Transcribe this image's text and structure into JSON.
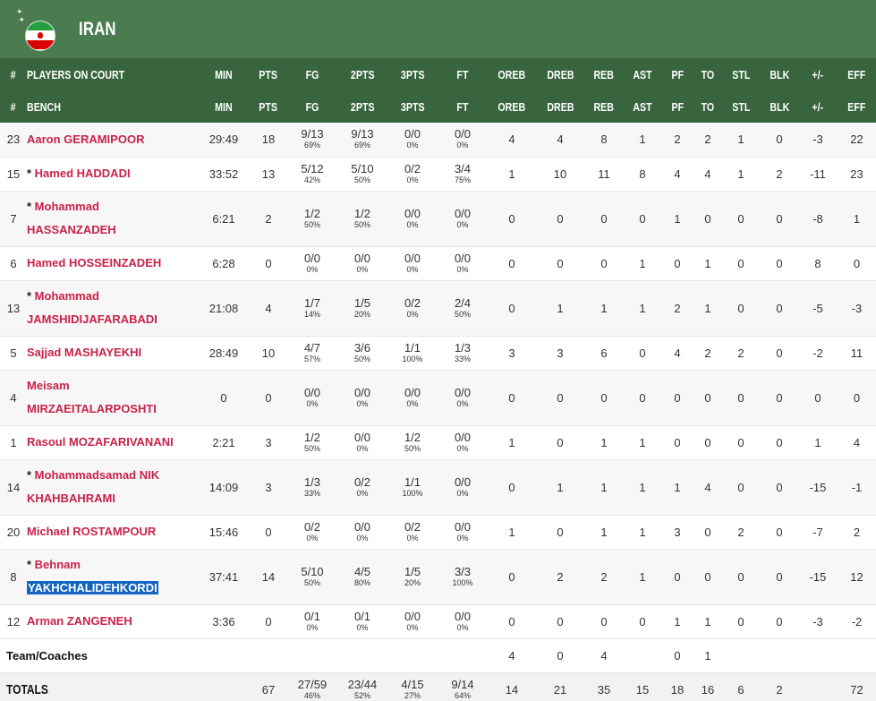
{
  "team": {
    "name": "IRAN",
    "colors": {
      "header": "#4b7c4f",
      "table_header": "#38653d",
      "player_link": "#c8224a"
    }
  },
  "columns_court": [
    "#",
    "PLAYERS ON COURT",
    "MIN",
    "PTS",
    "FG",
    "2PTS",
    "3PTS",
    "FT",
    "OREB",
    "DREB",
    "REB",
    "AST",
    "PF",
    "TO",
    "STL",
    "BLK",
    "+/-",
    "EFF"
  ],
  "columns_bench": [
    "#",
    "BENCH",
    "MIN",
    "PTS",
    "FG",
    "2PTS",
    "3PTS",
    "FT",
    "OREB",
    "DREB",
    "REB",
    "AST",
    "PF",
    "TO",
    "STL",
    "BLK",
    "+/-",
    "EFF"
  ],
  "players": [
    {
      "no": "23",
      "star": false,
      "name1": "Aaron GERAMIPOOR",
      "name2": "",
      "min": "29:49",
      "pts": "18",
      "fg": "9/13",
      "fg_pct": "69%",
      "p2": "9/13",
      "p2_pct": "69%",
      "p3": "0/0",
      "p3_pct": "0%",
      "ft": "0/0",
      "ft_pct": "0%",
      "oreb": "4",
      "dreb": "4",
      "reb": "8",
      "ast": "1",
      "pf": "2",
      "to": "2",
      "stl": "1",
      "blk": "0",
      "pm": "-3",
      "eff": "22"
    },
    {
      "no": "15",
      "star": true,
      "name1": "Hamed HADDADI",
      "name2": "",
      "min": "33:52",
      "pts": "13",
      "fg": "5/12",
      "fg_pct": "42%",
      "p2": "5/10",
      "p2_pct": "50%",
      "p3": "0/2",
      "p3_pct": "0%",
      "ft": "3/4",
      "ft_pct": "75%",
      "oreb": "1",
      "dreb": "10",
      "reb": "11",
      "ast": "8",
      "pf": "4",
      "to": "4",
      "stl": "1",
      "blk": "2",
      "pm": "-11",
      "eff": "23"
    },
    {
      "no": "7",
      "star": true,
      "name1": "Mohammad",
      "name2": "HASSANZADEH",
      "min": "6:21",
      "pts": "2",
      "fg": "1/2",
      "fg_pct": "50%",
      "p2": "1/2",
      "p2_pct": "50%",
      "p3": "0/0",
      "p3_pct": "0%",
      "ft": "0/0",
      "ft_pct": "0%",
      "oreb": "0",
      "dreb": "0",
      "reb": "0",
      "ast": "0",
      "pf": "1",
      "to": "0",
      "stl": "0",
      "blk": "0",
      "pm": "-8",
      "eff": "1"
    },
    {
      "no": "6",
      "star": false,
      "name1": "Hamed HOSSEINZADEH",
      "name2": "",
      "min": "6:28",
      "pts": "0",
      "fg": "0/0",
      "fg_pct": "0%",
      "p2": "0/0",
      "p2_pct": "0%",
      "p3": "0/0",
      "p3_pct": "0%",
      "ft": "0/0",
      "ft_pct": "0%",
      "oreb": "0",
      "dreb": "0",
      "reb": "0",
      "ast": "1",
      "pf": "0",
      "to": "1",
      "stl": "0",
      "blk": "0",
      "pm": "8",
      "eff": "0"
    },
    {
      "no": "13",
      "star": true,
      "name1": "Mohammad",
      "name2": "JAMSHIDIJAFARABADI",
      "min": "21:08",
      "pts": "4",
      "fg": "1/7",
      "fg_pct": "14%",
      "p2": "1/5",
      "p2_pct": "20%",
      "p3": "0/2",
      "p3_pct": "0%",
      "ft": "2/4",
      "ft_pct": "50%",
      "oreb": "0",
      "dreb": "1",
      "reb": "1",
      "ast": "1",
      "pf": "2",
      "to": "1",
      "stl": "0",
      "blk": "0",
      "pm": "-5",
      "eff": "-3"
    },
    {
      "no": "5",
      "star": false,
      "name1": "Sajjad MASHAYEKHI",
      "name2": "",
      "min": "28:49",
      "pts": "10",
      "fg": "4/7",
      "fg_pct": "57%",
      "p2": "3/6",
      "p2_pct": "50%",
      "p3": "1/1",
      "p3_pct": "100%",
      "ft": "1/3",
      "ft_pct": "33%",
      "oreb": "3",
      "dreb": "3",
      "reb": "6",
      "ast": "0",
      "pf": "4",
      "to": "2",
      "stl": "2",
      "blk": "0",
      "pm": "-2",
      "eff": "11"
    },
    {
      "no": "4",
      "star": false,
      "name1": "Meisam",
      "name2": "MIRZAEITALARPOSHTI",
      "min": "0",
      "pts": "0",
      "fg": "0/0",
      "fg_pct": "0%",
      "p2": "0/0",
      "p2_pct": "0%",
      "p3": "0/0",
      "p3_pct": "0%",
      "ft": "0/0",
      "ft_pct": "0%",
      "oreb": "0",
      "dreb": "0",
      "reb": "0",
      "ast": "0",
      "pf": "0",
      "to": "0",
      "stl": "0",
      "blk": "0",
      "pm": "0",
      "eff": "0"
    },
    {
      "no": "1",
      "star": false,
      "name1": "Rasoul MOZAFARIVANANI",
      "name2": "",
      "min": "2:21",
      "pts": "3",
      "fg": "1/2",
      "fg_pct": "50%",
      "p2": "0/0",
      "p2_pct": "0%",
      "p3": "1/2",
      "p3_pct": "50%",
      "ft": "0/0",
      "ft_pct": "0%",
      "oreb": "1",
      "dreb": "0",
      "reb": "1",
      "ast": "1",
      "pf": "0",
      "to": "0",
      "stl": "0",
      "blk": "0",
      "pm": "1",
      "eff": "4"
    },
    {
      "no": "14",
      "star": true,
      "name1": "Mohammadsamad NIK",
      "name2": "KHAHBAHRAMI",
      "min": "14:09",
      "pts": "3",
      "fg": "1/3",
      "fg_pct": "33%",
      "p2": "0/2",
      "p2_pct": "0%",
      "p3": "1/1",
      "p3_pct": "100%",
      "ft": "0/0",
      "ft_pct": "0%",
      "oreb": "0",
      "dreb": "1",
      "reb": "1",
      "ast": "1",
      "pf": "1",
      "to": "4",
      "stl": "0",
      "blk": "0",
      "pm": "-15",
      "eff": "-1"
    },
    {
      "no": "20",
      "star": false,
      "name1": "Michael ROSTAMPOUR",
      "name2": "",
      "min": "15:46",
      "pts": "0",
      "fg": "0/2",
      "fg_pct": "0%",
      "p2": "0/0",
      "p2_pct": "0%",
      "p3": "0/2",
      "p3_pct": "0%",
      "ft": "0/0",
      "ft_pct": "0%",
      "oreb": "1",
      "dreb": "0",
      "reb": "1",
      "ast": "1",
      "pf": "3",
      "to": "0",
      "stl": "2",
      "blk": "0",
      "pm": "-7",
      "eff": "2"
    },
    {
      "no": "8",
      "star": true,
      "name1": "Behnam",
      "name2": "YAKHCHALIDEHKORDI",
      "name2_selected": true,
      "min": "37:41",
      "pts": "14",
      "fg": "5/10",
      "fg_pct": "50%",
      "p2": "4/5",
      "p2_pct": "80%",
      "p3": "1/5",
      "p3_pct": "20%",
      "ft": "3/3",
      "ft_pct": "100%",
      "oreb": "0",
      "dreb": "2",
      "reb": "2",
      "ast": "1",
      "pf": "0",
      "to": "0",
      "stl": "0",
      "blk": "0",
      "pm": "-15",
      "eff": "12"
    },
    {
      "no": "12",
      "star": false,
      "name1": "Arman ZANGENEH",
      "name2": "",
      "min": "3:36",
      "pts": "0",
      "fg": "0/1",
      "fg_pct": "0%",
      "p2": "0/1",
      "p2_pct": "0%",
      "p3": "0/0",
      "p3_pct": "0%",
      "ft": "0/0",
      "ft_pct": "0%",
      "oreb": "0",
      "dreb": "0",
      "reb": "0",
      "ast": "0",
      "pf": "1",
      "to": "1",
      "stl": "0",
      "blk": "0",
      "pm": "-3",
      "eff": "-2"
    }
  ],
  "team_coaches": {
    "label": "Team/Coaches",
    "oreb": "4",
    "dreb": "0",
    "reb": "4",
    "pf": "0",
    "to": "1"
  },
  "totals": {
    "label": "TOTALS",
    "pts": "67",
    "fg": "27/59",
    "fg_pct": "46%",
    "p2": "23/44",
    "p2_pct": "52%",
    "p3": "4/15",
    "p3_pct": "27%",
    "ft": "9/14",
    "ft_pct": "64%",
    "oreb": "14",
    "dreb": "21",
    "reb": "35",
    "ast": "15",
    "pf": "18",
    "to": "16",
    "stl": "6",
    "blk": "2",
    "eff": "72"
  }
}
